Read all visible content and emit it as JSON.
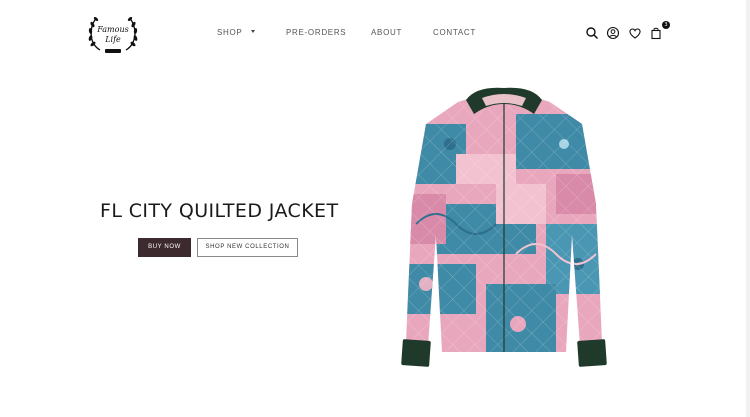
{
  "brand": {
    "logo_icon": "laurel-wreath-logo",
    "logo_text_line1": "Famous",
    "logo_text_line2": "Life"
  },
  "nav": {
    "items": [
      {
        "label": "SHOP",
        "has_dropdown": true
      },
      {
        "label": "PRE-ORDERS"
      },
      {
        "label": "ABOUT"
      },
      {
        "label": "CONTACT"
      }
    ]
  },
  "header_icons": {
    "search": "search-icon",
    "account": "account-icon",
    "wishlist": "heart-icon",
    "cart": "bag-icon",
    "cart_count": "3"
  },
  "hero": {
    "title": "FL CITY QUILTED JACKET",
    "primary_button": "BUY NOW",
    "secondary_button": "SHOP NEW COLLECTION",
    "product_image": "quilted-jacket-image"
  },
  "colors": {
    "primary_button_bg": "#3c2a2e",
    "jacket_collar": "#1f3a2b",
    "jacket_blue": "#3f8aa6",
    "jacket_pink": "#e9a7bd"
  }
}
